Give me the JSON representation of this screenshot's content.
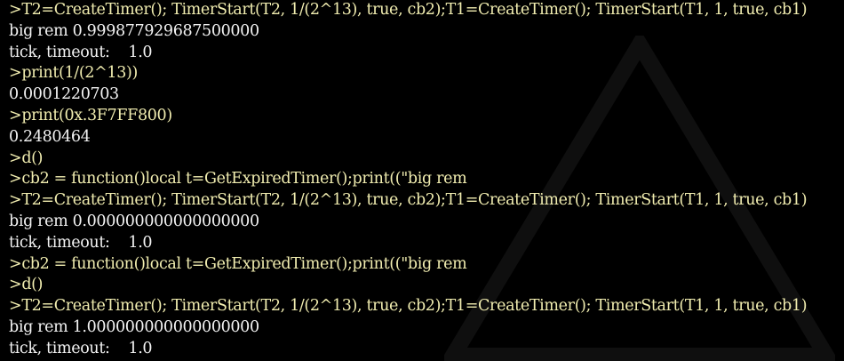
{
  "colors": {
    "background": "#000000",
    "command_text": "#f1edb0",
    "output_text": "#f3f3f3"
  },
  "console": {
    "lines": [
      {
        "kind": "cmd",
        "text": ">T2=CreateTimer(); TimerStart(T2, 1/(2^13), true, cb2);T1=CreateTimer(); TimerStart(T1, 1, true, cb1)"
      },
      {
        "kind": "out",
        "text": "big rem 0.999877929687500000"
      },
      {
        "kind": "out",
        "text": "tick, timeout:    1.0"
      },
      {
        "kind": "cmd",
        "text": ">print(1/(2^13))"
      },
      {
        "kind": "out",
        "text": "0.0001220703"
      },
      {
        "kind": "cmd",
        "text": ">print(0x.3F7FF800)"
      },
      {
        "kind": "out",
        "text": "0.2480464"
      },
      {
        "kind": "cmd",
        "text": ">d()"
      },
      {
        "kind": "cmd",
        "text": ">cb2 = function()local t=GetExpiredTimer();print((\"big rem"
      },
      {
        "kind": "cmd",
        "text": ">T2=CreateTimer(); TimerStart(T2, 1/(2^13), true, cb2);T1=CreateTimer(); TimerStart(T1, 1, true, cb1)"
      },
      {
        "kind": "out",
        "text": "big rem 0.000000000000000000"
      },
      {
        "kind": "out",
        "text": "tick, timeout:    1.0"
      },
      {
        "kind": "cmd",
        "text": ">cb2 = function()local t=GetExpiredTimer();print((\"big rem"
      },
      {
        "kind": "cmd",
        "text": ">d()"
      },
      {
        "kind": "cmd",
        "text": ">T2=CreateTimer(); TimerStart(T2, 1/(2^13), true, cb2);T1=CreateTimer(); TimerStart(T1, 1, true, cb1)"
      },
      {
        "kind": "out",
        "text": "big rem 1.000000000000000000"
      },
      {
        "kind": "out",
        "text": "tick, timeout:    1.0"
      }
    ]
  }
}
